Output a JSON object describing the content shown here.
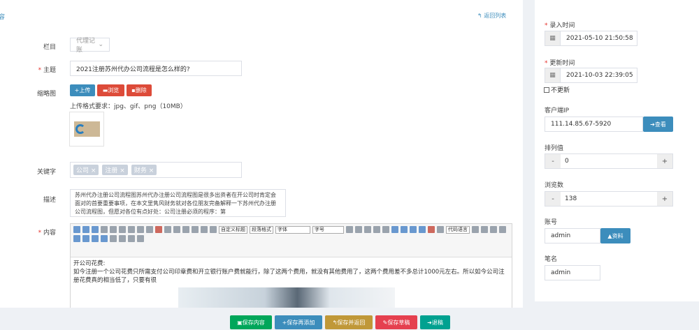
{
  "header": {
    "cut_text": "容",
    "back_link": "返回列表"
  },
  "form": {
    "column": {
      "label": "栏目",
      "value": "代理记账"
    },
    "title": {
      "label": "主题",
      "value": "2021注册苏州代办公司流程是怎么样的?"
    },
    "thumb": {
      "label": "缩略图",
      "upload": "上传",
      "browse": "浏览",
      "delete": "删除",
      "hint": "上传格式要求：jpg、gif、png（10MB）"
    },
    "keywords": {
      "label": "关键字",
      "tags": [
        "公司",
        "注册",
        "财务"
      ]
    },
    "description": {
      "label": "描述",
      "text": "苏州代办注册公司流程图苏州代办注册公司流程图是很多出资者在开公司时肯定会面对的首要重要事项，在本文里隽风财务就对各位朋友完备解释一下苏州代办注册公司流程图，但愿对各位有点好处：公司注册必须的程序：第"
    },
    "content": {
      "label": "内容",
      "toolbar": {
        "custom_title": "自定义标题",
        "para_format": "段落格式",
        "font": "字体",
        "size": "字号",
        "code_lang": "代码语言"
      },
      "heading": "开公司花费:",
      "body": "如今注册一个公司花费只所需支付公司印章费和开立银行账户费就能行，除了这两个费用，就没有其他费用了，这两个费用差不多总计1000元左右。所以如今公司注册花费真的相当低了，只要有很"
    }
  },
  "actions": [
    "保存内容",
    "保存再添加",
    "保存并返回",
    "保存草稿",
    "退稿"
  ],
  "sidebar": {
    "entry_time": {
      "label": "录入时间",
      "value": "2021-05-10 21:50:58"
    },
    "update_time": {
      "label": "更新时间",
      "value": "2021-10-03 22:39:05"
    },
    "no_update": "不更新",
    "client_ip": {
      "label": "客户端IP",
      "value": "111.14.85.67-5920",
      "button": "查看"
    },
    "sort": {
      "label": "排列值",
      "value": "0"
    },
    "views": {
      "label": "浏览数",
      "value": "138"
    },
    "account": {
      "label": "账号",
      "value": "admin",
      "button": "资料"
    },
    "author": {
      "label": "笔名",
      "value": "admin"
    }
  },
  "colors": {
    "blue": "#3c8dbc",
    "red": "#dd4b39",
    "green": "#00a65a",
    "orange": "#c09838",
    "action_red": "#e5404f",
    "teal": "#00a190"
  }
}
